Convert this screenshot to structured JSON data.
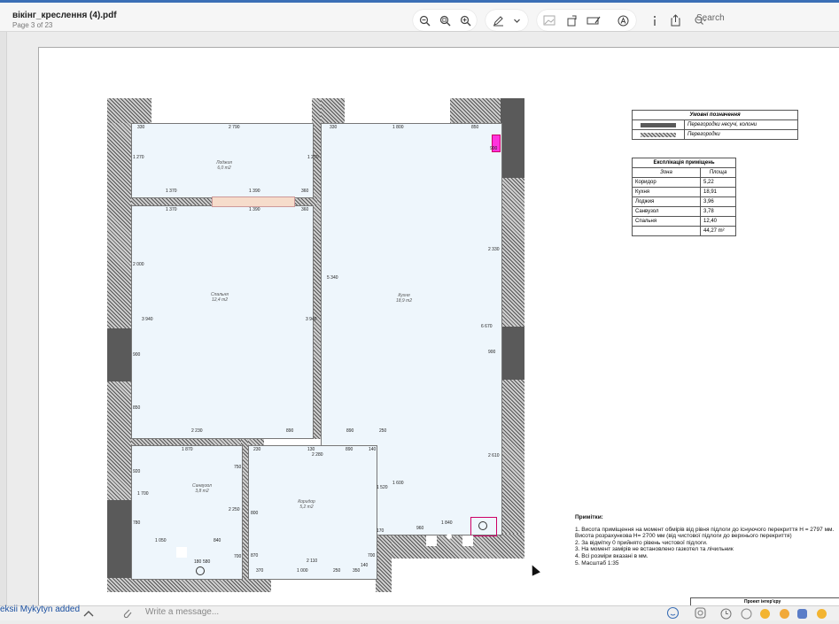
{
  "header": {
    "file_name": "вікінг_креслення (4).pdf",
    "page_info": "Page 3 of 23",
    "search_label": "Search"
  },
  "toolbar": {
    "icons": [
      "zoom-out-icon",
      "zoom-fit-icon",
      "zoom-in-icon",
      "pen-icon",
      "chevron-down-icon",
      "image-icon",
      "rotate-icon",
      "markup-icon",
      "text-a-icon",
      "info-icon",
      "share-icon",
      "search-icon"
    ]
  },
  "plan": {
    "rooms": {
      "loggia": {
        "name": "Лоджия",
        "area": "6,0 m2"
      },
      "bedroom": {
        "name": "Спальня",
        "area": "12,4 m2"
      },
      "kitchen": {
        "name": "Кухня",
        "area": "18,9 m2"
      },
      "bath": {
        "name": "Санвузол",
        "area": "3,8 m2"
      },
      "corridor": {
        "name": "Коридор",
        "area": "5,2 m2"
      }
    },
    "dims": {
      "d1": "330",
      "d2": "2 790",
      "d3": "330",
      "d4": "1 800",
      "d5": "850",
      "d6": "1 370",
      "d7": "1 390",
      "d8": "360",
      "d9": "1 370",
      "d10": "1 390",
      "d11": "360",
      "d12": "1 270",
      "d13": "1 270",
      "d14": "2 000",
      "d15": "3 940",
      "d16": "3 940",
      "d17": "5 340",
      "d18": "2 330",
      "d19": "6 670",
      "d20": "900",
      "d21": "900",
      "d22": "900",
      "d23": "850",
      "d24": "2 230",
      "d25": "890",
      "d26": "890",
      "d27": "250",
      "d28": "1 870",
      "d29": "230",
      "d30": "130",
      "d31": "2 280",
      "d32": "890",
      "d33": "140",
      "d34": "920",
      "d35": "1 700",
      "d36": "780",
      "d37": "750",
      "d38": "2 250",
      "d39": "800",
      "d40": "1 520",
      "d41": "1 600",
      "d42": "2 610",
      "d43": "1 050",
      "d44": "840",
      "d45": "180",
      "d46": "580",
      "d47": "700",
      "d48": "870",
      "d49": "370",
      "d50": "1 000",
      "d51": "250",
      "d52": "350",
      "d53": "140",
      "d54": "2 110",
      "d55": "700",
      "d56": "170",
      "d57": "960",
      "d58": "1 840"
    }
  },
  "legend": {
    "title": "Умовні позначення",
    "rows": [
      "Перегородки несучі, колони",
      "Перегородки"
    ]
  },
  "explication": {
    "title": "Експлікація приміщень",
    "headers": [
      "Зона",
      "Площа"
    ],
    "rows": [
      [
        "Коридор",
        "5,22"
      ],
      [
        "Кухня",
        "18,91"
      ],
      [
        "Лоджия",
        "3,96"
      ],
      [
        "Санвузол",
        "3,78"
      ],
      [
        "Спальня",
        "12,40"
      ]
    ],
    "total": "44,27 m²"
  },
  "notes": {
    "title": "Примітки:",
    "lines": [
      "1. Висота приміщення на момент обмірів від рівня підлоги до існуючого перекриття H = 2797 мм.",
      "Висота розрахункова H= 2700 мм (від чистової підлоги до верхнього перекриття)",
      "2. За відмітку 0 прийнято рівень чистової підлоги.",
      "3. На момент замірів не встановлено газкотел та лічильник",
      "4. Всі розміри вказані в мм.",
      "5. Масштаб 1:35"
    ]
  },
  "stamp": {
    "label": "Проект інтер'єру"
  },
  "chat": {
    "sender": "eksii Mykytyn added",
    "placeholder": "Write a message..."
  }
}
